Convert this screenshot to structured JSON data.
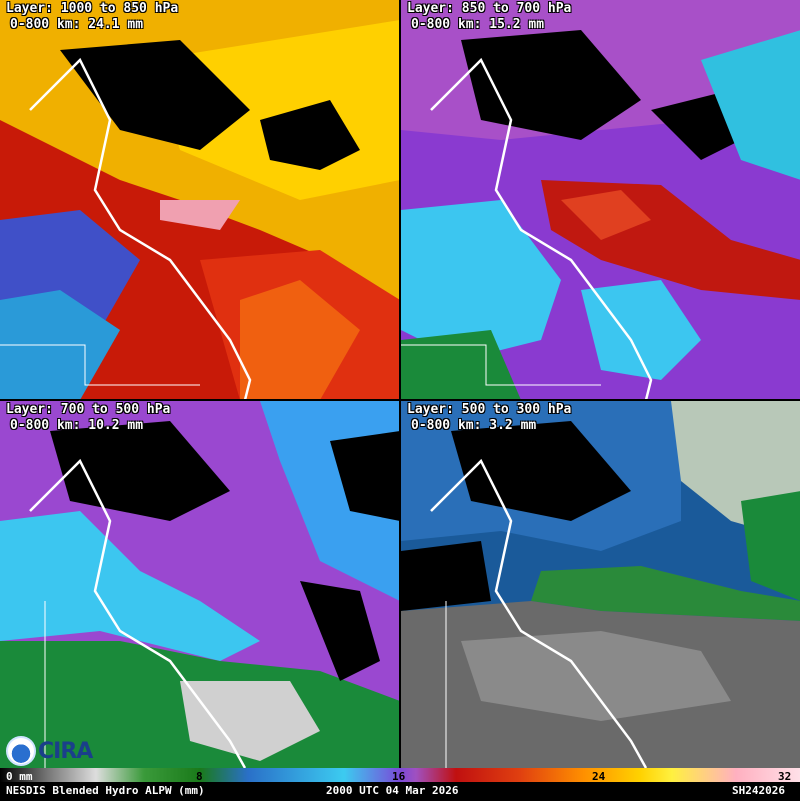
{
  "panels": [
    {
      "layer": "Layer: 1000 to 850 hPa",
      "stat": "0-800 km: 24.1 mm",
      "theme": "low"
    },
    {
      "layer": "Layer: 850 to 700 hPa",
      "stat": "0-800 km: 15.2 mm",
      "theme": "mid"
    },
    {
      "layer": "Layer: 700 to 500 hPa",
      "stat": "0-800 km: 10.2 mm",
      "theme": "upper"
    },
    {
      "layer": "Layer: 500 to 300 hPa",
      "stat": "0-800 km: 3.2 mm",
      "theme": "top"
    }
  ],
  "colorbar": {
    "ticks": [
      "0 mm",
      "8",
      "16",
      "24",
      "32"
    ]
  },
  "footer": {
    "product": "NESDIS Blended Hydro ALPW (mm)",
    "time": "2000 UTC 04 Mar 2026",
    "id": "SH242026"
  },
  "logo": {
    "cira": "CIRA",
    "noaa": "noaa-logo"
  }
}
